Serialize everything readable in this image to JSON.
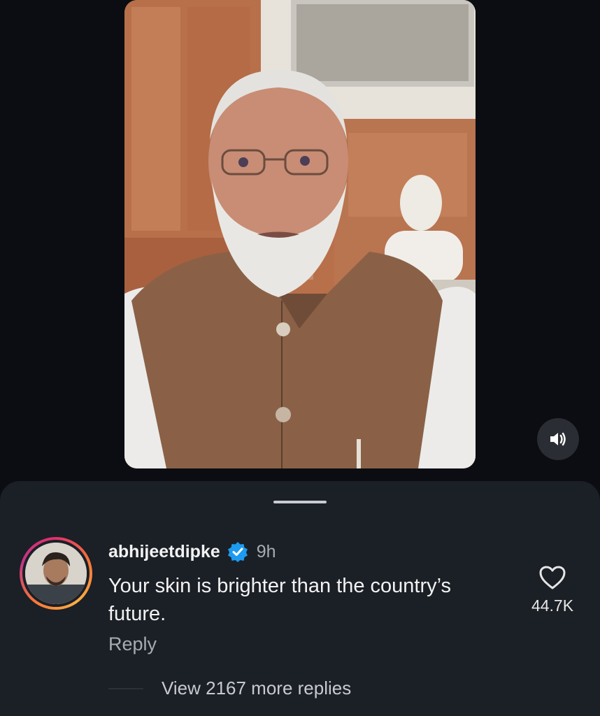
{
  "video": {
    "sound_icon": "speaker-sound-icon"
  },
  "comment": {
    "username": "abhijeetdipke",
    "verified_icon": "verified-badge-icon",
    "time": "9h",
    "text": "Your skin is brighter than the country’s future.",
    "reply_label": "Reply",
    "like_icon": "heart-icon",
    "like_count": "44.7K",
    "view_more_label": "View 2167 more replies"
  },
  "colors": {
    "background": "#0b0d12",
    "sheet": "#1b1f26",
    "verified": "#1d9bf0",
    "muted_text": "#a8abb2"
  }
}
